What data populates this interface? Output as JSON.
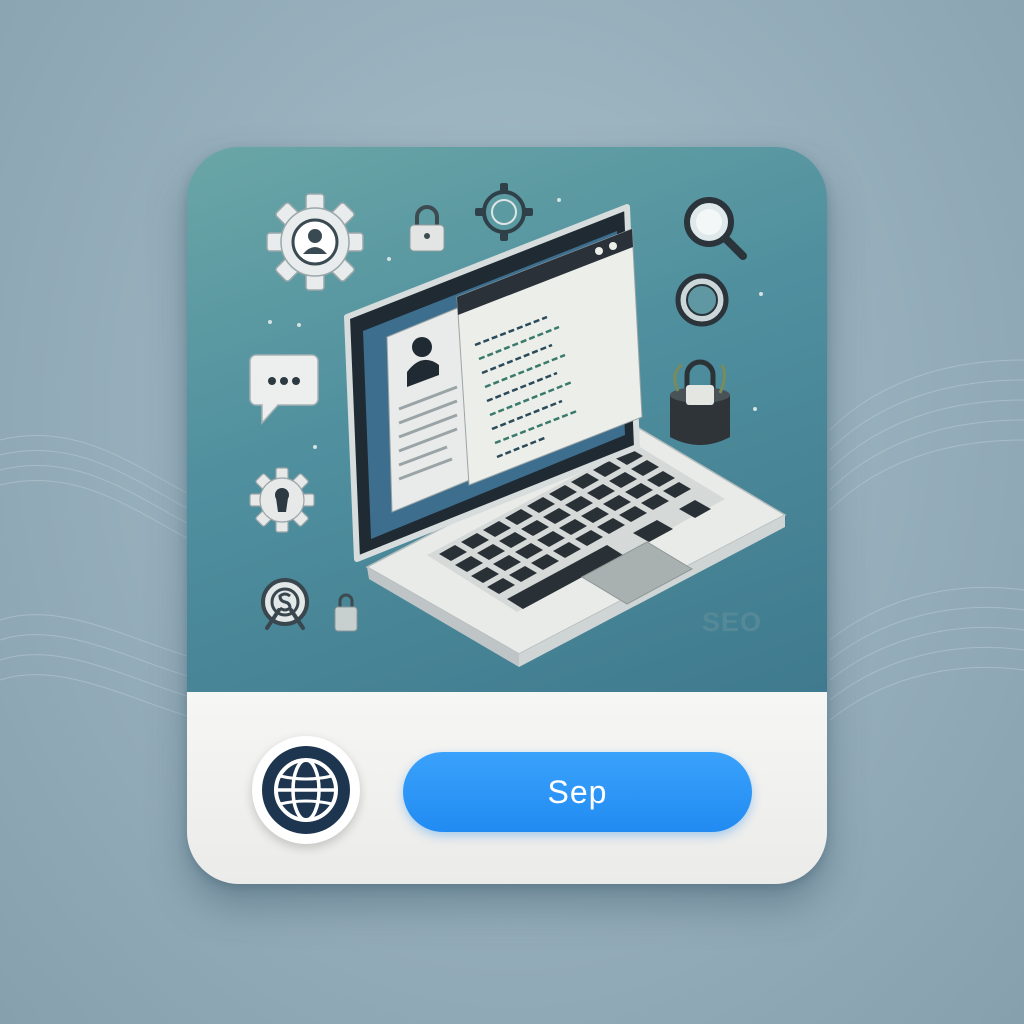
{
  "card": {
    "seo_label": "SEO",
    "primary_button_label": "Sep"
  },
  "icons": [
    "user-gear-icon",
    "lock-icon",
    "gear-outline-icon",
    "search-icon",
    "ring-icon",
    "padlock-cup-icon",
    "chat-bubble-icon",
    "keyhole-gear-icon",
    "dollar-target-icon",
    "small-lock-icon",
    "laptop-illustration",
    "globe-icon"
  ],
  "colors": {
    "card_top": "#4f8f9e",
    "button": "#2a93f6",
    "globe_dark": "#1e3550"
  }
}
